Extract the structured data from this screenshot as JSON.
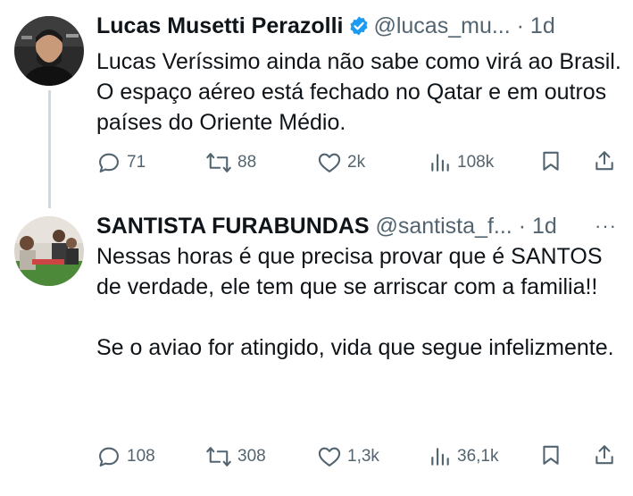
{
  "tweets": [
    {
      "name": "Lucas Musetti Perazolli",
      "handle": "@lucas_mu...",
      "separator": "·",
      "time": "1d",
      "text": "Lucas Veríssimo ainda não sabe como virá ao Brasil. O espaço aéreo está fechado no Qatar e em outros países do Oriente Médio.",
      "replies": "71",
      "retweets": "88",
      "likes": "2k",
      "views": "108k"
    },
    {
      "name": "SANTISTA FURABUNDAS",
      "handle": "@santista_f...",
      "separator": "·",
      "time": "1d",
      "more": "···",
      "text": "Nessas horas é que precisa provar que é SANTOS de verdade, ele tem que se arriscar com a familia!!\n\nSe o aviao for atingido, vida que segue infelizmente.",
      "replies": "108",
      "retweets": "308",
      "likes": "1,3k",
      "views": "36,1k"
    }
  ],
  "colors": {
    "text": "#0f1419",
    "muted": "#536471",
    "verified": "#1d9bf0",
    "thread_line": "#cfd9de"
  }
}
